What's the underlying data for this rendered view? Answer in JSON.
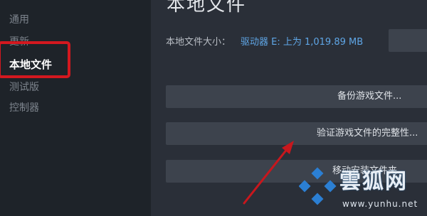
{
  "sidebar": {
    "items": [
      {
        "label": "通用"
      },
      {
        "label": "更新"
      },
      {
        "label": "本地文件",
        "active": true
      },
      {
        "label": "测试版"
      },
      {
        "label": "控制器"
      }
    ]
  },
  "main": {
    "title": "本地文件",
    "local_size_label": "本地文件大小：",
    "local_size_value": "驱动器 E: 上为 1,019.89 MB",
    "buttons": {
      "backup": "备份游戏文件...",
      "verify": "验证游戏文件的完整性...",
      "move": "移动安装文件夹..."
    }
  },
  "watermark": {
    "text": "雲狐网",
    "url": "www.yunhu.net"
  },
  "colors": {
    "highlight": "#d3181f",
    "link": "#5fa6e6"
  }
}
